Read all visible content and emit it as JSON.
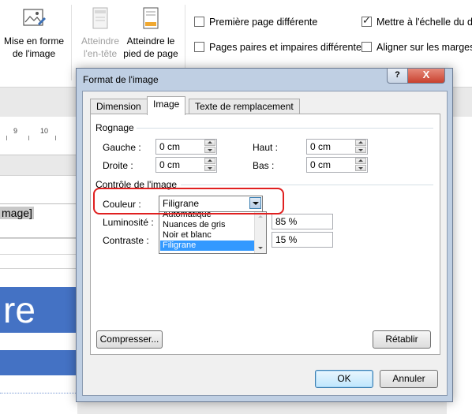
{
  "ribbon": {
    "btn_picture_format_line1": "Mise en forme",
    "btn_picture_format_line2": "de l'image",
    "btn_goto_header_line1": "Atteindre",
    "btn_goto_header_line2": "l'en-tête",
    "btn_goto_footer_line1": "Atteindre le",
    "btn_goto_footer_line2": "pied de page",
    "chk_first_page": "Première page différente",
    "chk_odd_even": "Pages paires et impaires différentes",
    "chk_scale": "Mettre à l'échelle du do",
    "chk_align": "Aligner sur les marges d",
    "chk_first_page_checked": false,
    "chk_odd_even_checked": false,
    "chk_scale_checked": true,
    "chk_align_checked": false
  },
  "document": {
    "ruler_numbers": [
      "9",
      "10"
    ],
    "field_text": "mage]",
    "big_text": "re"
  },
  "dialog": {
    "title": "Format de l'image",
    "help": "?",
    "close": "X",
    "tabs": [
      "Dimension",
      "Image",
      "Texte de remplacement"
    ],
    "active_tab": "Image",
    "crop": {
      "group_label": "Rognage",
      "left_label": "Gauche :",
      "left_value": "0 cm",
      "top_label": "Haut :",
      "top_value": "0 cm",
      "right_label": "Droite :",
      "right_value": "0 cm",
      "bottom_label": "Bas :",
      "bottom_value": "0 cm"
    },
    "image_control": {
      "group_label": "Contrôle de l'image",
      "color_label": "Couleur :",
      "color_value": "Filigrane",
      "color_options": [
        "Automatique",
        "Nuances de gris",
        "Noir et blanc",
        "Filigrane"
      ],
      "brightness_label": "Luminosité :",
      "brightness_value": "85 %",
      "contrast_label": "Contraste :",
      "contrast_value": "15 %"
    },
    "compress_button": "Compresser...",
    "reset_button": "Rétablir",
    "ok_button": "OK",
    "cancel_button": "Annuler"
  },
  "colors": {
    "accent_blue": "#4472c4",
    "highlight_red": "#e02020",
    "selection_blue": "#3399ff"
  }
}
